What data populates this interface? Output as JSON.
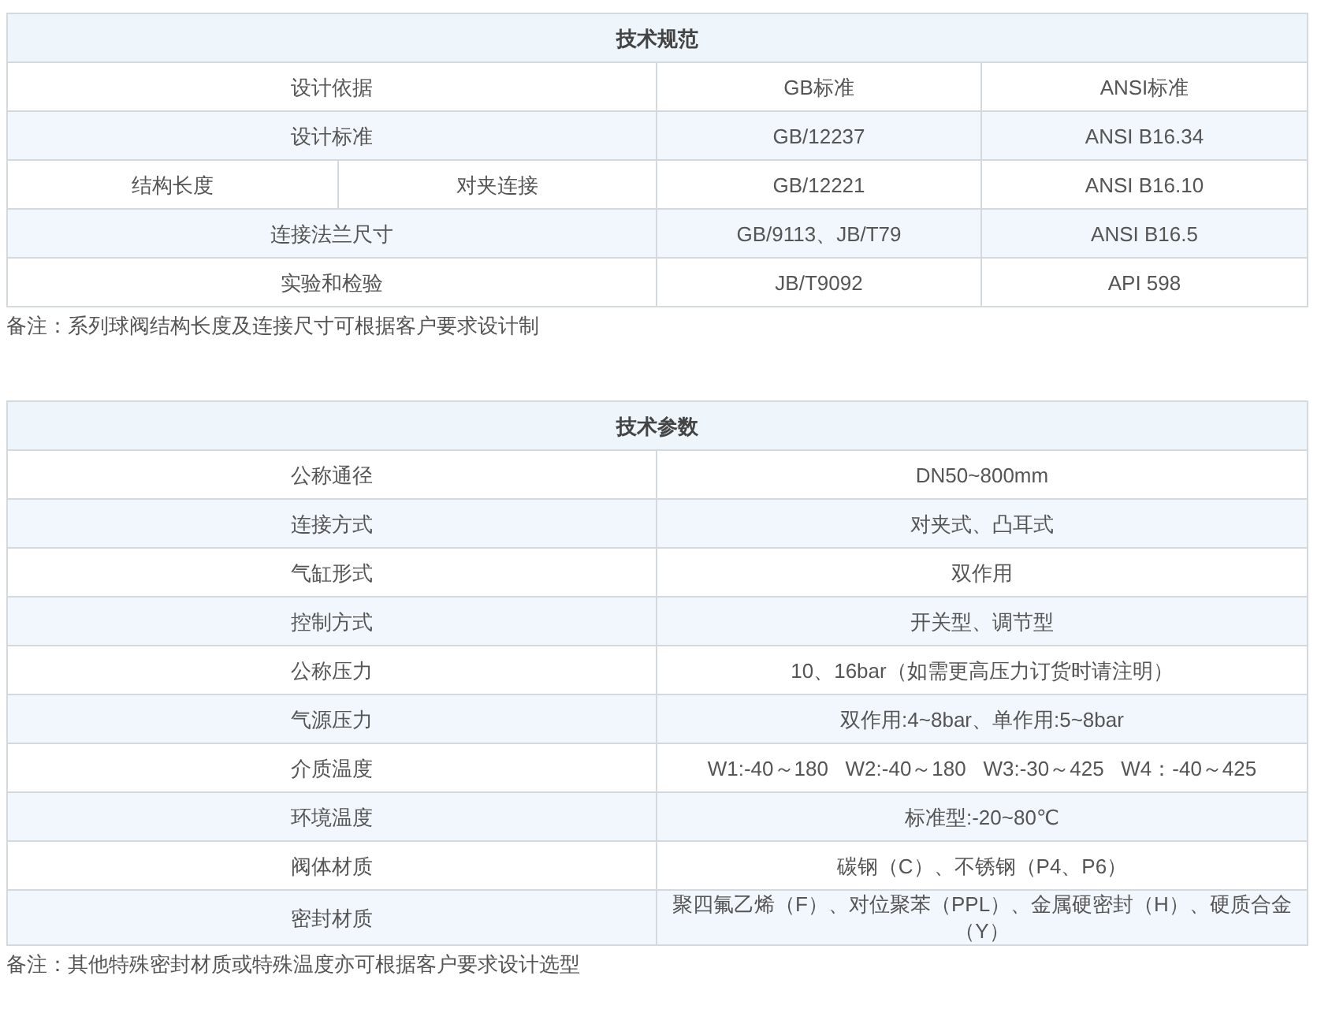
{
  "spec_table": {
    "title": "技术规范",
    "rows": [
      {
        "item": "设计依据",
        "gb": "GB标准",
        "ansi": "ANSI标准"
      },
      {
        "item": "设计标准",
        "gb": "GB/12237",
        "ansi": "ANSI B16.34"
      },
      {
        "item": "结构长度",
        "detail": "对夹连接",
        "gb": "GB/12221",
        "ansi": "ANSI B16.10"
      },
      {
        "item": "连接法兰尺寸",
        "gb": "GB/9113、JB/T79",
        "ansi": "ANSI B16.5"
      },
      {
        "item": "实验和检验",
        "gb": "JB/T9092",
        "ansi": "API 598"
      }
    ]
  },
  "spec_note": "备注：系列球阀结构长度及连接尺寸可根据客户要求设计制",
  "param_table": {
    "title": "技术参数",
    "rows": [
      {
        "cells": [
          "公称通径",
          "DN50~800mm"
        ]
      },
      {
        "cells": [
          "连接方式",
          "对夹式、凸耳式"
        ]
      },
      {
        "cells": [
          "气缸形式",
          "双作用"
        ]
      },
      {
        "cells": [
          "控制方式",
          "开关型、调节型"
        ]
      },
      {
        "cells": [
          "公称压力",
          "10、16bar（如需更高压力订货时请注明）"
        ]
      },
      {
        "cells": [
          "气源压力",
          "双作用:4~8bar、单作用:5~8bar"
        ]
      },
      {
        "cells": [
          "介质温度",
          "W1:-40～180   W2:-40～180   W3:-30～425   W4：-40～425"
        ]
      },
      {
        "cells": [
          "环境温度",
          "标准型:-20~80℃"
        ]
      },
      {
        "cells": [
          "阀体材质",
          "碳钢（C）、不锈钢（P4、P6）"
        ]
      },
      {
        "cells": [
          "密封材质",
          "聚四氟乙烯（F）、对位聚苯（PPL）、金属硬密封（H）、硬质合金（Y）"
        ]
      }
    ]
  },
  "param_note": "备注：其他特殊密封材质或特殊温度亦可根据客户要求设计选型"
}
